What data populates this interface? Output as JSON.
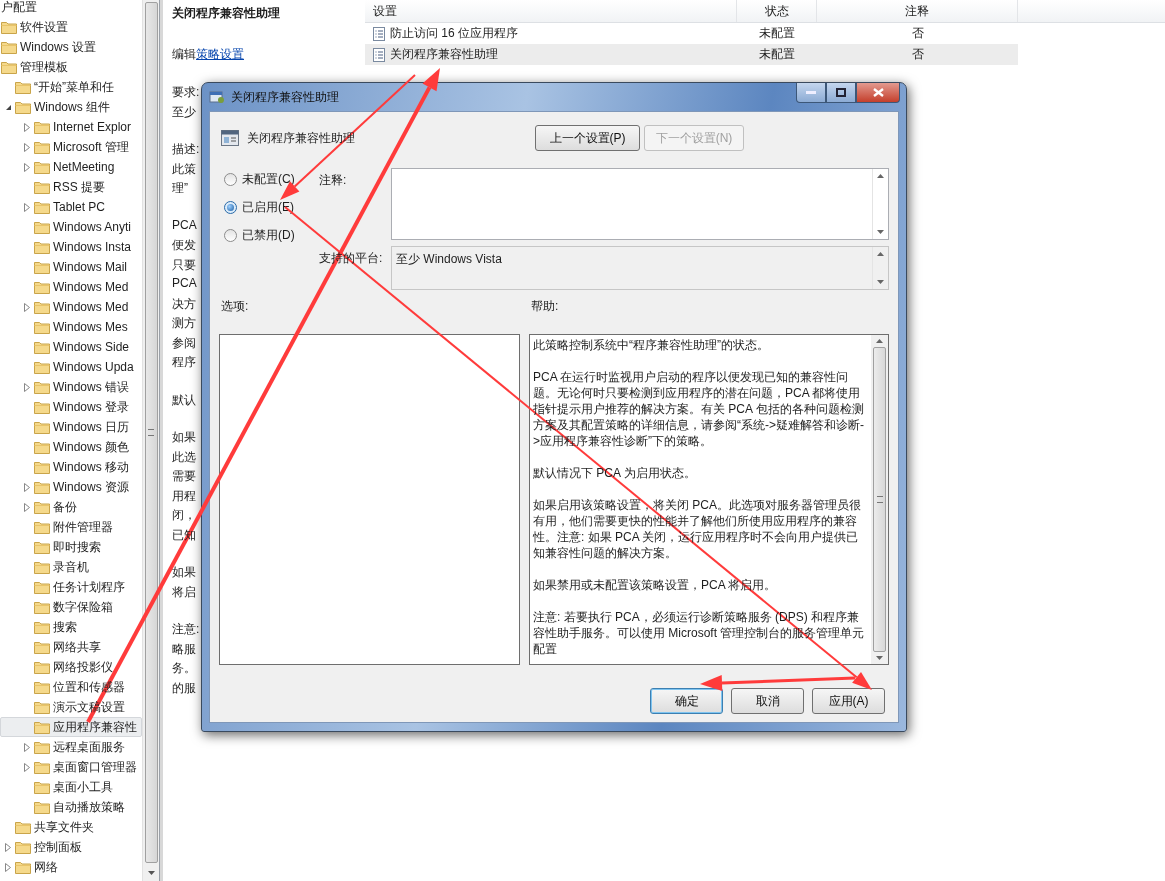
{
  "tree": [
    {
      "label": "户配置",
      "selected": false,
      "children": [
        {
          "label": "软件设置",
          "selected": false
        },
        {
          "label": "Windows 设置",
          "selected": false
        },
        {
          "label": "管理模板",
          "selected": false,
          "children": [
            {
              "label": "“开始”菜单和任",
              "selected": false
            },
            {
              "label": "Windows 组件",
              "selected": false,
              "expanded": true,
              "children": [
                {
                  "label": "Internet Explor",
                  "selected": false,
                  "expanded": false
                },
                {
                  "label": "Microsoft 管理",
                  "selected": false,
                  "expanded": false
                },
                {
                  "label": "NetMeeting",
                  "selected": false,
                  "expanded": false
                },
                {
                  "label": "RSS 提要",
                  "selected": false
                },
                {
                  "label": "Tablet PC",
                  "selected": false,
                  "expanded": false
                },
                {
                  "label": "Windows Anyti",
                  "selected": false
                },
                {
                  "label": "Windows Insta",
                  "selected": false
                },
                {
                  "label": "Windows Mail",
                  "selected": false
                },
                {
                  "label": "Windows Med",
                  "selected": false
                },
                {
                  "label": "Windows Med",
                  "selected": false,
                  "expanded": false
                },
                {
                  "label": "Windows Mes",
                  "selected": false
                },
                {
                  "label": "Windows Side",
                  "selected": false
                },
                {
                  "label": "Windows Upda",
                  "selected": false
                },
                {
                  "label": "Windows 错误",
                  "selected": false,
                  "expanded": false
                },
                {
                  "label": "Windows 登录",
                  "selected": false
                },
                {
                  "label": "Windows 日历",
                  "selected": false
                },
                {
                  "label": "Windows 颜色",
                  "selected": false
                },
                {
                  "label": "Windows 移动",
                  "selected": false
                },
                {
                  "label": "Windows 资源",
                  "selected": false,
                  "expanded": false
                },
                {
                  "label": "备份",
                  "selected": false,
                  "expanded": false
                },
                {
                  "label": "附件管理器",
                  "selected": false
                },
                {
                  "label": "即时搜索",
                  "selected": false
                },
                {
                  "label": "录音机",
                  "selected": false
                },
                {
                  "label": "任务计划程序",
                  "selected": false
                },
                {
                  "label": "数字保险箱",
                  "selected": false
                },
                {
                  "label": "搜索",
                  "selected": false
                },
                {
                  "label": "网络共享",
                  "selected": false
                },
                {
                  "label": "网络投影仪",
                  "selected": false
                },
                {
                  "label": "位置和传感器",
                  "selected": false
                },
                {
                  "label": "演示文稿设置",
                  "selected": false
                },
                {
                  "label": "应用程序兼容性",
                  "selected": true
                },
                {
                  "label": "远程桌面服务",
                  "selected": false,
                  "expanded": false
                },
                {
                  "label": "桌面窗口管理器",
                  "selected": false,
                  "expanded": false
                },
                {
                  "label": "桌面小工具",
                  "selected": false
                },
                {
                  "label": "自动播放策略",
                  "selected": false
                }
              ]
            },
            {
              "label": "共享文件夹",
              "selected": false
            },
            {
              "label": "控制面板",
              "selected": false,
              "expanded": false
            },
            {
              "label": "网络",
              "selected": false,
              "expanded": false
            }
          ]
        }
      ]
    }
  ],
  "description": {
    "title": "关闭程序兼容性助理",
    "edit_prefix": "编辑",
    "edit_link": "策略设置",
    "paragraphs": [
      [
        "要求:",
        "至少"
      ],
      [
        "描述:",
        "此策",
        "理”"
      ],
      [
        "PCA",
        "便发",
        "只要",
        "PCA",
        "决方",
        "测方",
        "参阅",
        "程序"
      ],
      [
        "默认"
      ],
      [
        "如果",
        "此选",
        "需要",
        "用程",
        "闭，",
        "已知"
      ],
      [
        "如果",
        "将启"
      ],
      [
        "注意:",
        "略服",
        "务。",
        "的服"
      ]
    ]
  },
  "table": {
    "columns": [
      "设置",
      "状态",
      "注释"
    ],
    "rows": [
      {
        "cells": [
          "防止访问 16 位应用程序",
          "未配置",
          "否"
        ],
        "selected": false
      },
      {
        "cells": [
          "关闭程序兼容性助理",
          "未配置",
          "否"
        ],
        "selected": true
      }
    ]
  },
  "dialog": {
    "title": "关闭程序兼容性助理",
    "heading": "关闭程序兼容性助理",
    "nav_buttons": [
      {
        "label": "上一个设置(P)",
        "disabled": false
      },
      {
        "label": "下一个设置(N)",
        "disabled": true
      }
    ],
    "states": [
      {
        "label": "未配置(C)",
        "selected": false
      },
      {
        "label": "已启用(E)",
        "selected": true
      },
      {
        "label": "已禁用(D)",
        "selected": false
      }
    ],
    "comment_label": "注释:",
    "platform_label": "支持的平台:",
    "platform_value": "至少 Windows Vista",
    "options_label": "选项:",
    "help_label": "帮助:",
    "help_paragraphs": [
      "此策略控制系统中“程序兼容性助理”的状态。",
      "PCA 在运行时监视用户启动的程序以便发现已知的兼容性问题。无论何时只要检测到应用程序的潜在问题，PCA 都将使用指针提示用户推荐的解决方案。有关 PCA 包括的各种问题检测方案及其配置策略的详细信息，请参阅“系统->疑难解答和诊断->应用程序兼容性诊断”下的策略。",
      "默认情况下 PCA 为启用状态。",
      "如果启用该策略设置，将关闭 PCA。此选项对服务器管理员很有用，他们需要更快的性能并了解他们所使用应用程序的兼容性。注意: 如果 PCA 关闭，运行应用程序时不会向用户提供已知兼容性问题的解决方案。",
      "如果禁用或未配置该策略设置，PCA 将启用。",
      "注意: 若要执行 PCA，必须运行诊断策略服务 (DPS) 和程序兼容性助手服务。可以使用 Microsoft 管理控制台的服务管理单元配置"
    ],
    "buttons": [
      {
        "label": "确定",
        "default": true
      },
      {
        "label": "取消",
        "default": false
      },
      {
        "label": "应用(A)",
        "default": false
      }
    ]
  }
}
